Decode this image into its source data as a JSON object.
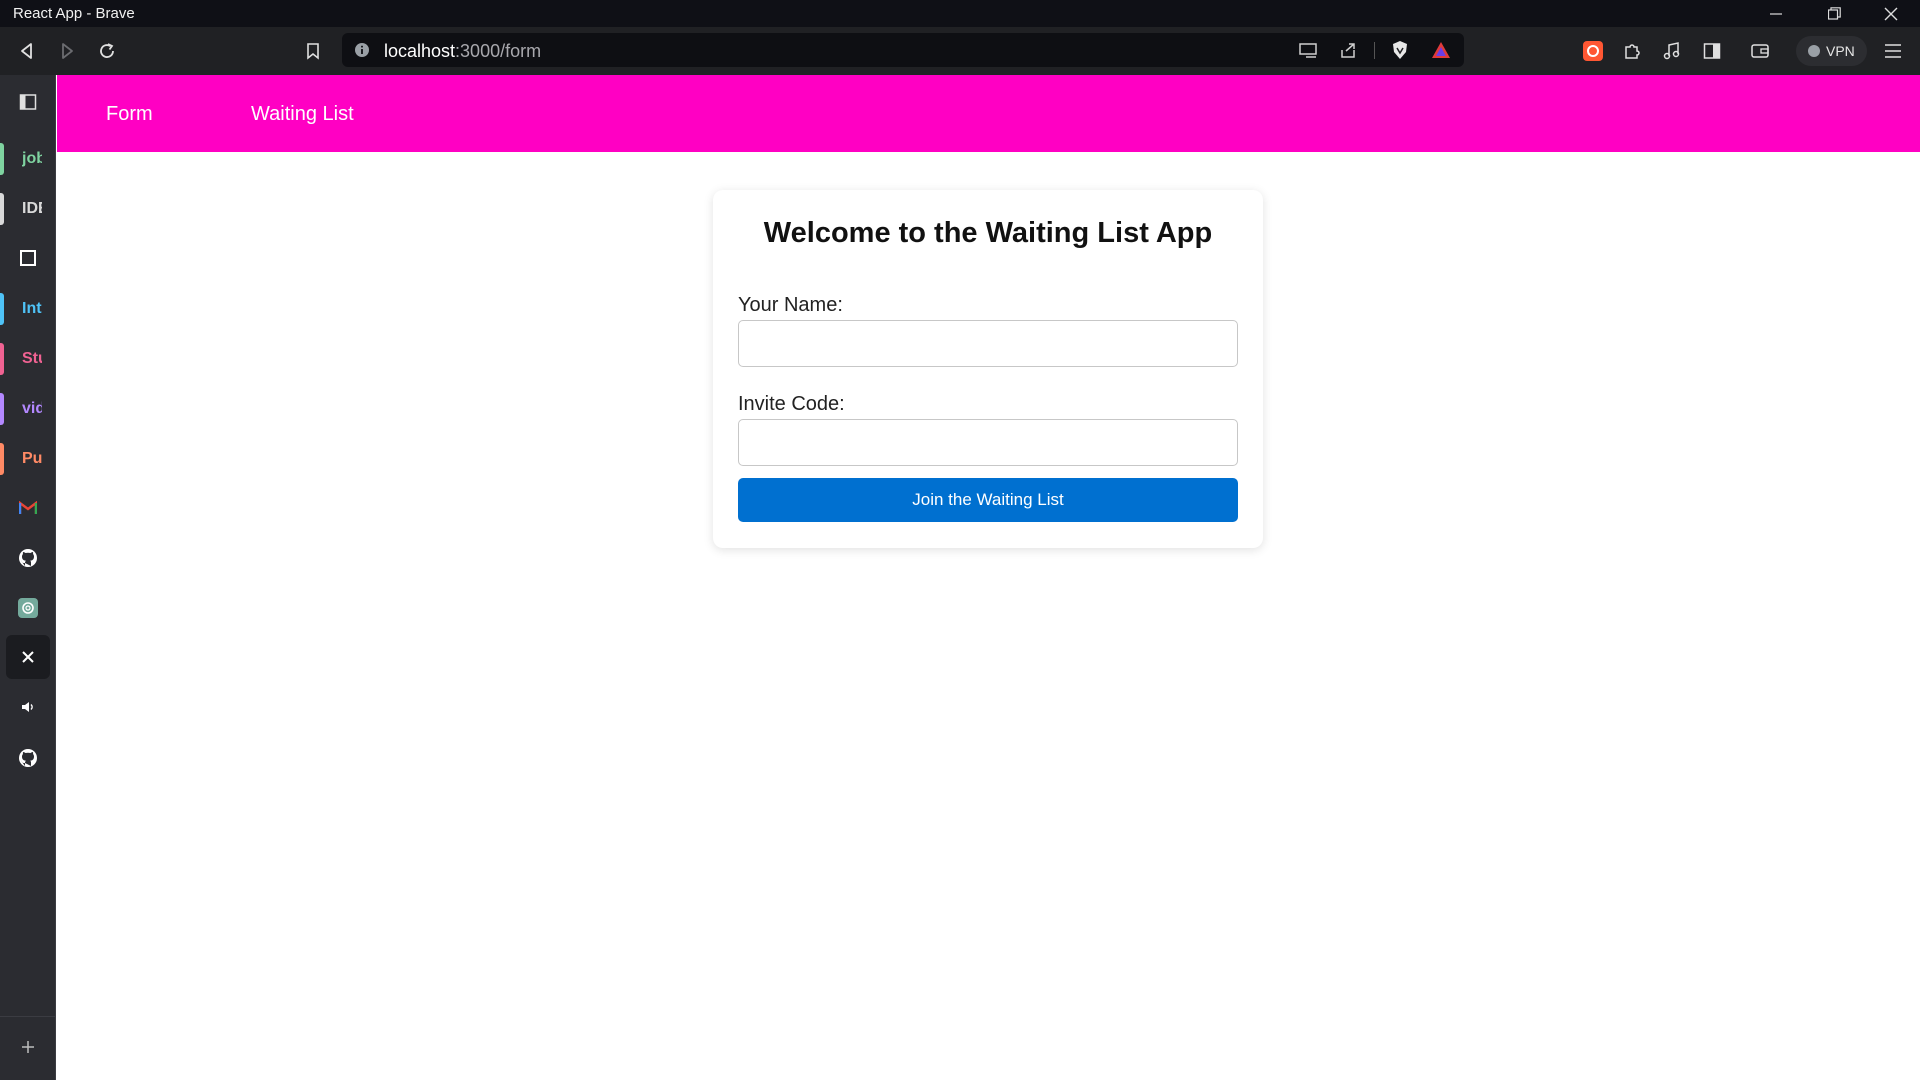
{
  "window": {
    "title": "React App - Brave"
  },
  "toolbar": {
    "url_host": "localhost",
    "url_path": ":3000/form",
    "vpn_label": "VPN"
  },
  "sidebar": {
    "items": [
      {
        "label": "job",
        "color": "#7fd3a0"
      },
      {
        "label": "IDE",
        "color": "#d9d9d9"
      },
      {
        "label": "Int",
        "color": "#4fc3f7"
      },
      {
        "label": "Stu",
        "color": "#f06292"
      },
      {
        "label": "vid",
        "color": "#b388ff"
      },
      {
        "label": "Pu",
        "color": "#ff8a65"
      }
    ]
  },
  "nav": {
    "form_label": "Form",
    "waiting_list_label": "Waiting List",
    "bg_color": "#ff00c3"
  },
  "form": {
    "heading": "Welcome to the Waiting List App",
    "name_label": "Your Name:",
    "name_value": "",
    "invite_label": "Invite Code:",
    "invite_value": "",
    "submit_label": "Join the Waiting List",
    "button_color": "#0070d0"
  }
}
